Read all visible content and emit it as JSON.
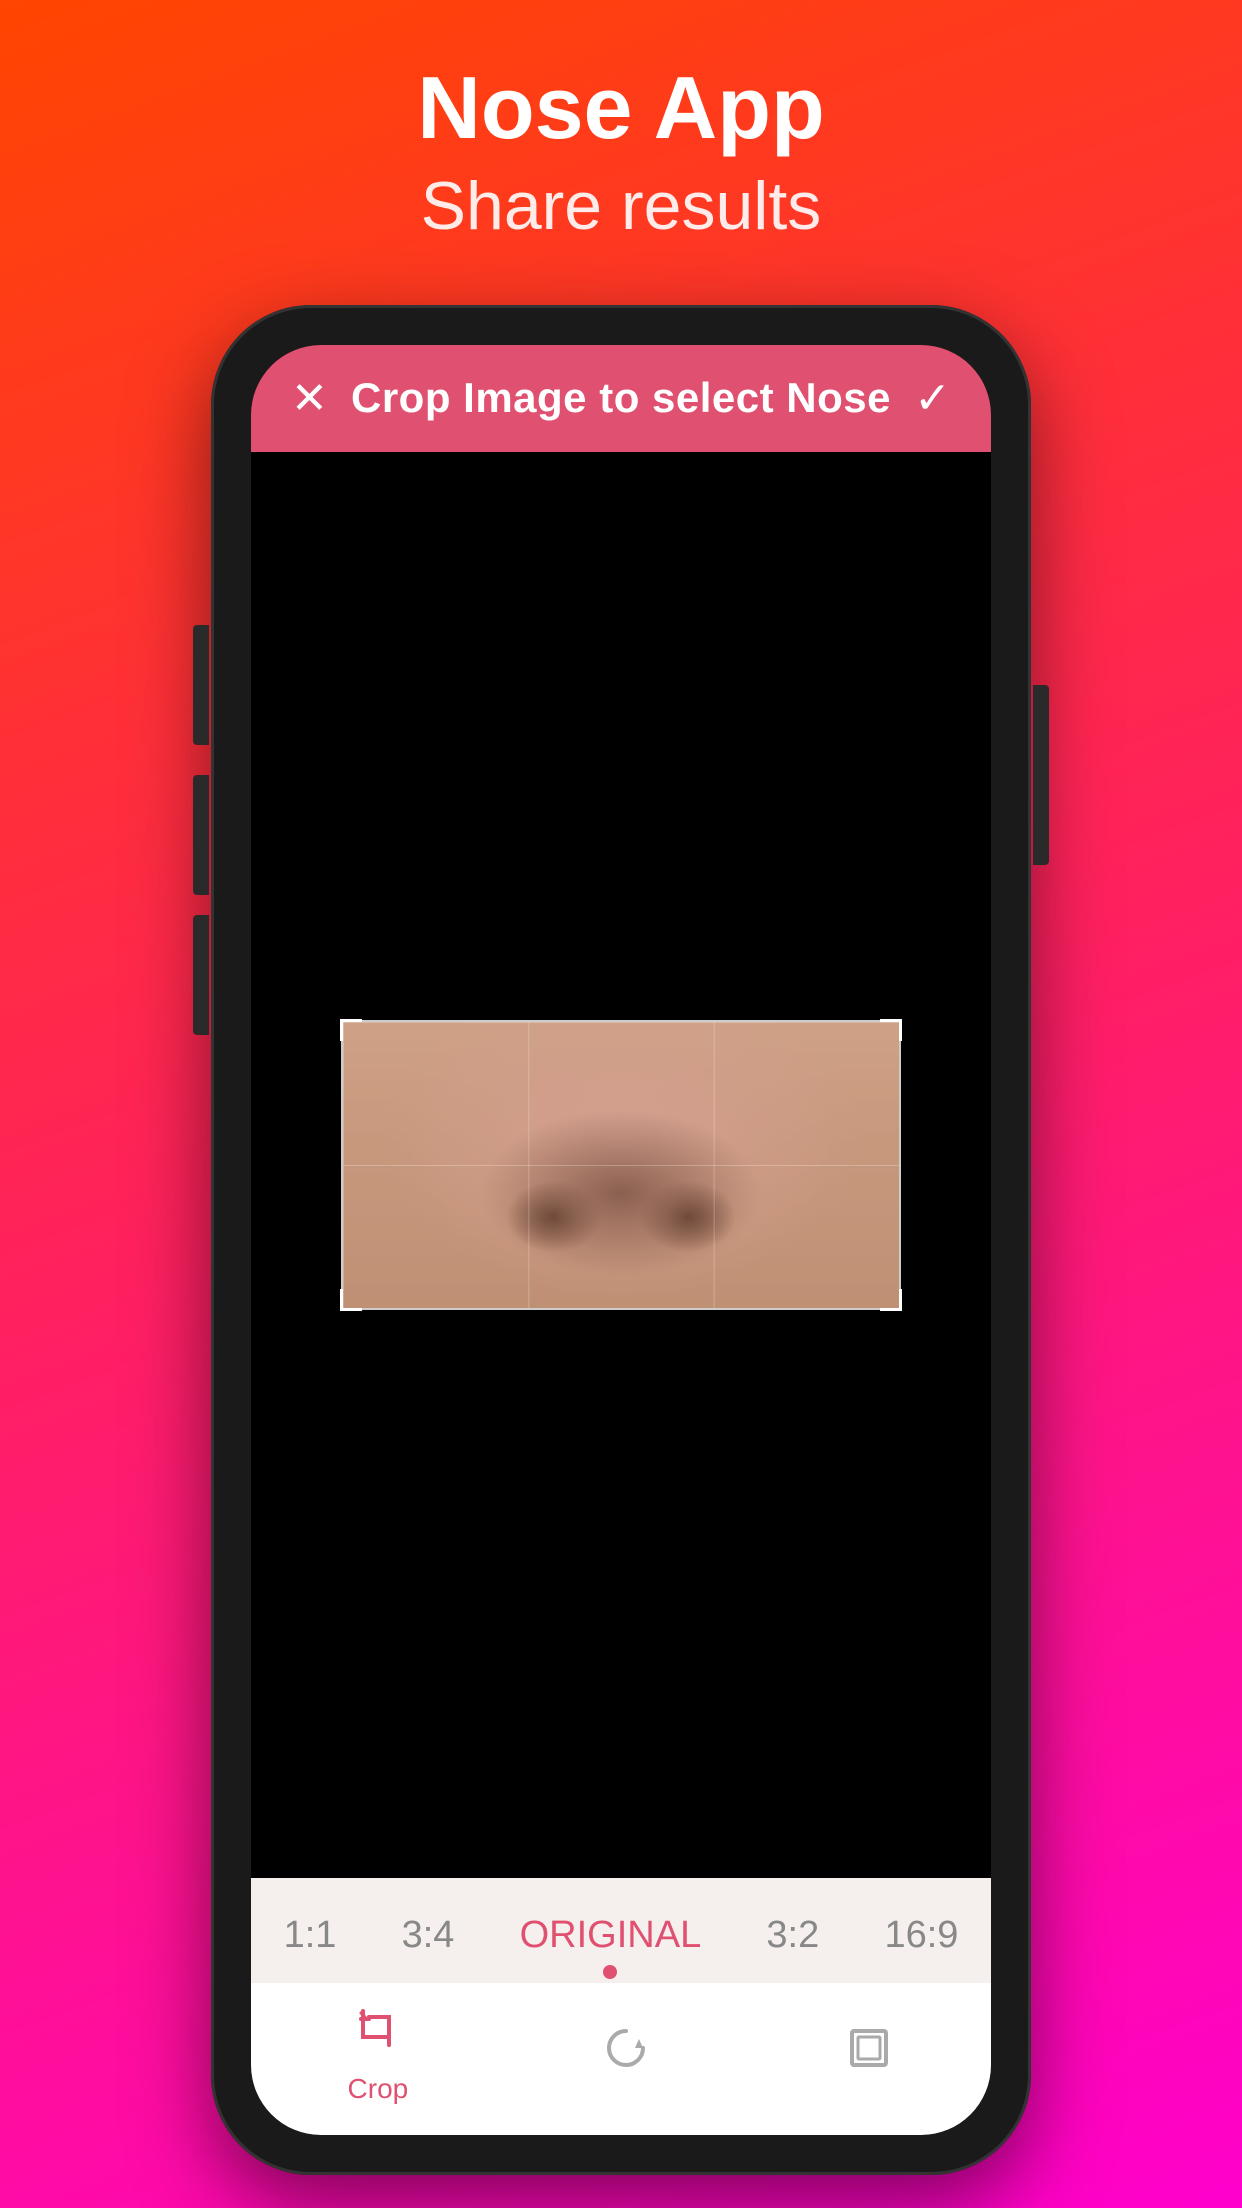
{
  "header": {
    "title": "Nose App",
    "subtitle": "Share results"
  },
  "crop_bar": {
    "title": "Crop Image to select Nose",
    "close_icon": "✕",
    "confirm_icon": "✓"
  },
  "aspect_ratios": [
    {
      "label": "1:1",
      "active": false
    },
    {
      "label": "3:4",
      "active": false
    },
    {
      "label": "ORIGINAL",
      "active": true
    },
    {
      "label": "3:2",
      "active": false
    },
    {
      "label": "16:9",
      "active": false
    }
  ],
  "toolbar": {
    "crop": {
      "label": "Crop",
      "icon": "crop-icon"
    },
    "rotate": {
      "icon": "rotate-icon"
    },
    "expand": {
      "icon": "expand-icon"
    }
  },
  "colors": {
    "accent": "#e05070",
    "bg_gradient_start": "#ff4500",
    "bg_gradient_end": "#ff00cc",
    "phone_bg": "#1a1a1a",
    "screen_bg": "#000000"
  }
}
